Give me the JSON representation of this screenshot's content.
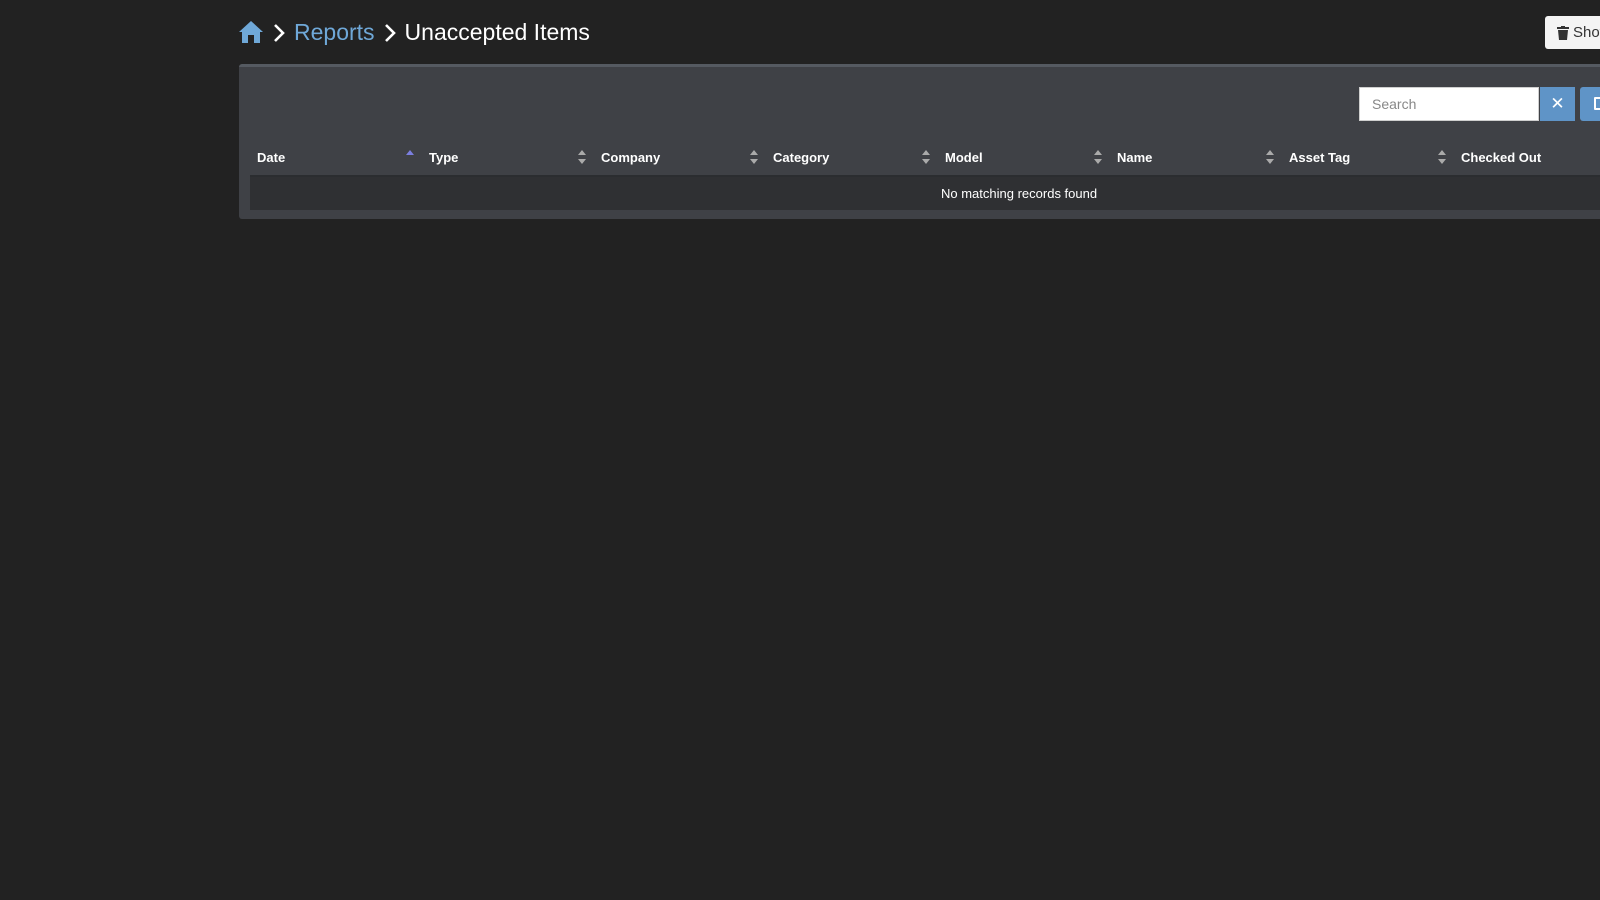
{
  "breadcrumb": {
    "home_icon": "home-icon",
    "reports_label": "Reports",
    "current_label": "Unaccepted Items"
  },
  "toolbar": {
    "top_button_label": "Show",
    "top_button_icon": "trash-icon",
    "search_placeholder": "Search",
    "clear_icon": "close-icon",
    "clear_label": "✕"
  },
  "table": {
    "columns": [
      {
        "label": "Date",
        "sort": "asc"
      },
      {
        "label": "Type",
        "sort": "none"
      },
      {
        "label": "Company",
        "sort": "none"
      },
      {
        "label": "Category",
        "sort": "none"
      },
      {
        "label": "Model",
        "sort": "none"
      },
      {
        "label": "Name",
        "sort": "none"
      },
      {
        "label": "Asset Tag",
        "sort": "none"
      },
      {
        "label": "Checked Out",
        "sort": "none"
      }
    ],
    "empty_message": "No matching records found"
  },
  "colors": {
    "background": "#222222",
    "panel": "#3f4146",
    "link": "#6fa8d8",
    "accent_button": "#5f94c7",
    "sort_active": "#7b7fe0"
  }
}
